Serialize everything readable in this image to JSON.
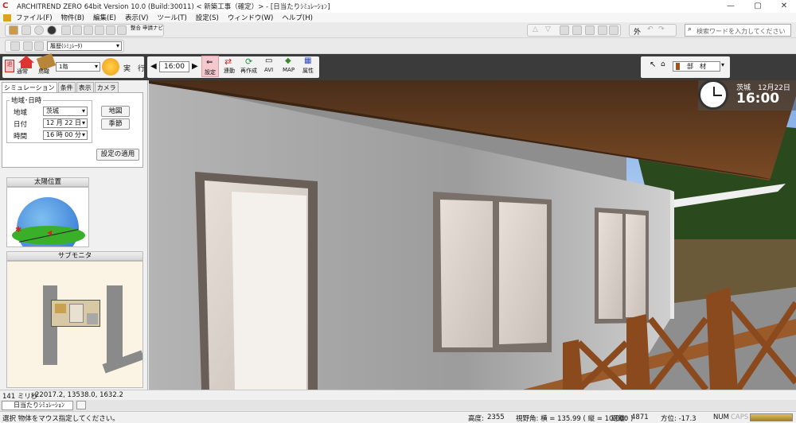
{
  "window": {
    "title": "ARCHITREND ZERO 64bit Version 10.0 (Build:30011) <        新築工事（確定）> - [日当たりｼﾐｭﾚｰｼｮﾝ]"
  },
  "menu": [
    "ファイル(F)",
    "物件(B)",
    "編集(E)",
    "表示(V)",
    "ツール(T)",
    "設定(S)",
    "ウィンドウ(W)",
    "ヘルプ(H)"
  ],
  "toolbar": {
    "plan_label": "履歴(ｼﾐｭﾚｰﾀ)",
    "seiri_label": "整合",
    "shinsei_label": "申請",
    "navi_label": "ナビ",
    "soto_label": "外",
    "search_placeholder": "検索ワードを入力してください"
  },
  "simbar": {
    "floor_value": "1階",
    "btn_normal": "通常",
    "btn_bird": "鳥瞰",
    "run_label": "実　行",
    "time_value": "16:00",
    "btn_settei": "設定",
    "btn_rendou": "連動",
    "btn_saisakusei": "再作成",
    "btn_avi": "AVI",
    "btn_map": "MAP",
    "btn_zokusei": "属性",
    "material_label": "部　材"
  },
  "leftpanel": {
    "tabs": [
      "シミュレーション",
      "条件",
      "表示",
      "カメラ"
    ],
    "group_title": "地域･日時",
    "region_label": "地域",
    "region_value": "茨城",
    "date_label": "日付",
    "date_value": "12 月 22 日",
    "time_label": "時間",
    "time_value": "16 時 00 分",
    "btn_map": "地図",
    "btn_season": "季節",
    "btn_apply": "設定の適用",
    "sun_title": "太陽位置",
    "monitor_title": "サブモニタ"
  },
  "overlay": {
    "location": "茨城",
    "date": "12月22日",
    "time": "16:00"
  },
  "coordbar": {
    "render_time": "141 ミリ秒",
    "coords": "22017.2, 13538.0, 1632.2"
  },
  "doctab": {
    "label": "日当たりｼﾐｭﾚｰｼｮﾝ"
  },
  "statusbar": {
    "message": "選択 物体をマウス指定してください。",
    "height_label": "高度:",
    "height_value": "2355",
    "fov_text": "視野角: 横 = 135.99 ( 縦 = 10.000 )",
    "dist_label": "距離:",
    "dist_value": "4871",
    "dir_text": "方位: -17.3",
    "num": "NUM",
    "caps": "CAPS"
  },
  "colors": {
    "accent": "#c8202a",
    "toolbar": "#eaeaea",
    "dark_toolbar": "#3a3a3a"
  }
}
